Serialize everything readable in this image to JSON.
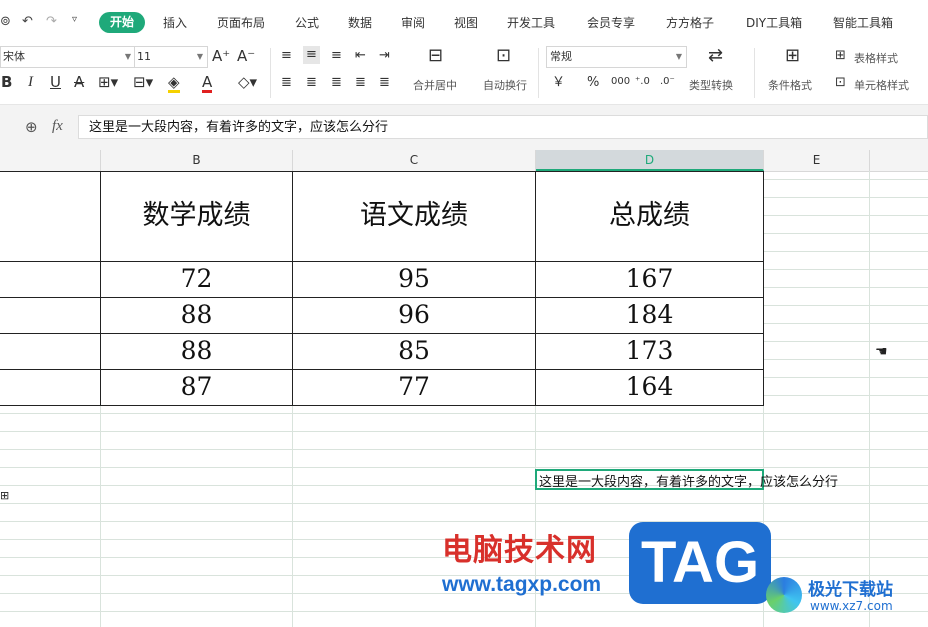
{
  "tabs": [
    "开始",
    "插入",
    "页面布局",
    "公式",
    "数据",
    "审阅",
    "视图",
    "开发工具",
    "会员专享",
    "方方格子",
    "DIY工具箱",
    "智能工具箱"
  ],
  "active_tab": "开始",
  "ribbon": {
    "font_name": "宋体",
    "font_size": "11",
    "number_format": "常规",
    "merge_label": "合并居中",
    "wrap_label": "自动换行",
    "type_convert_label": "类型转换",
    "cond_format_label": "条件格式",
    "table_style_label": "表格样式",
    "cell_style_label": "单元格样式",
    "bold": "B",
    "italic": "I",
    "underline": "U",
    "strike": "A",
    "currency": "￥",
    "percent": "%",
    "thousands": "000"
  },
  "formula_bar": {
    "fx_label": "fx",
    "content": "这里是一大段内容，有着许多的文字，应该怎么分行"
  },
  "columns": [
    "B",
    "C",
    "D",
    "E"
  ],
  "table": {
    "headers": [
      "数学成绩",
      "语文成绩",
      "总成绩"
    ],
    "rows": [
      [
        "72",
        "95",
        "167"
      ],
      [
        "88",
        "96",
        "184"
      ],
      [
        "88",
        "85",
        "173"
      ],
      [
        "87",
        "77",
        "164"
      ]
    ]
  },
  "cell_text": "这里是一大段内容，有着许多的文字，应该怎么分行",
  "colors": {
    "accent": "#1fa97a",
    "watermark_red": "#d8302b",
    "watermark_blue": "#1f6fd1"
  },
  "watermark": {
    "site_name": "电脑技术网",
    "site_url": "www.tagxp.com",
    "tag_logo": "TAG",
    "xz7_name": "极光下载站",
    "xz7_url": "www.xz7.com"
  }
}
